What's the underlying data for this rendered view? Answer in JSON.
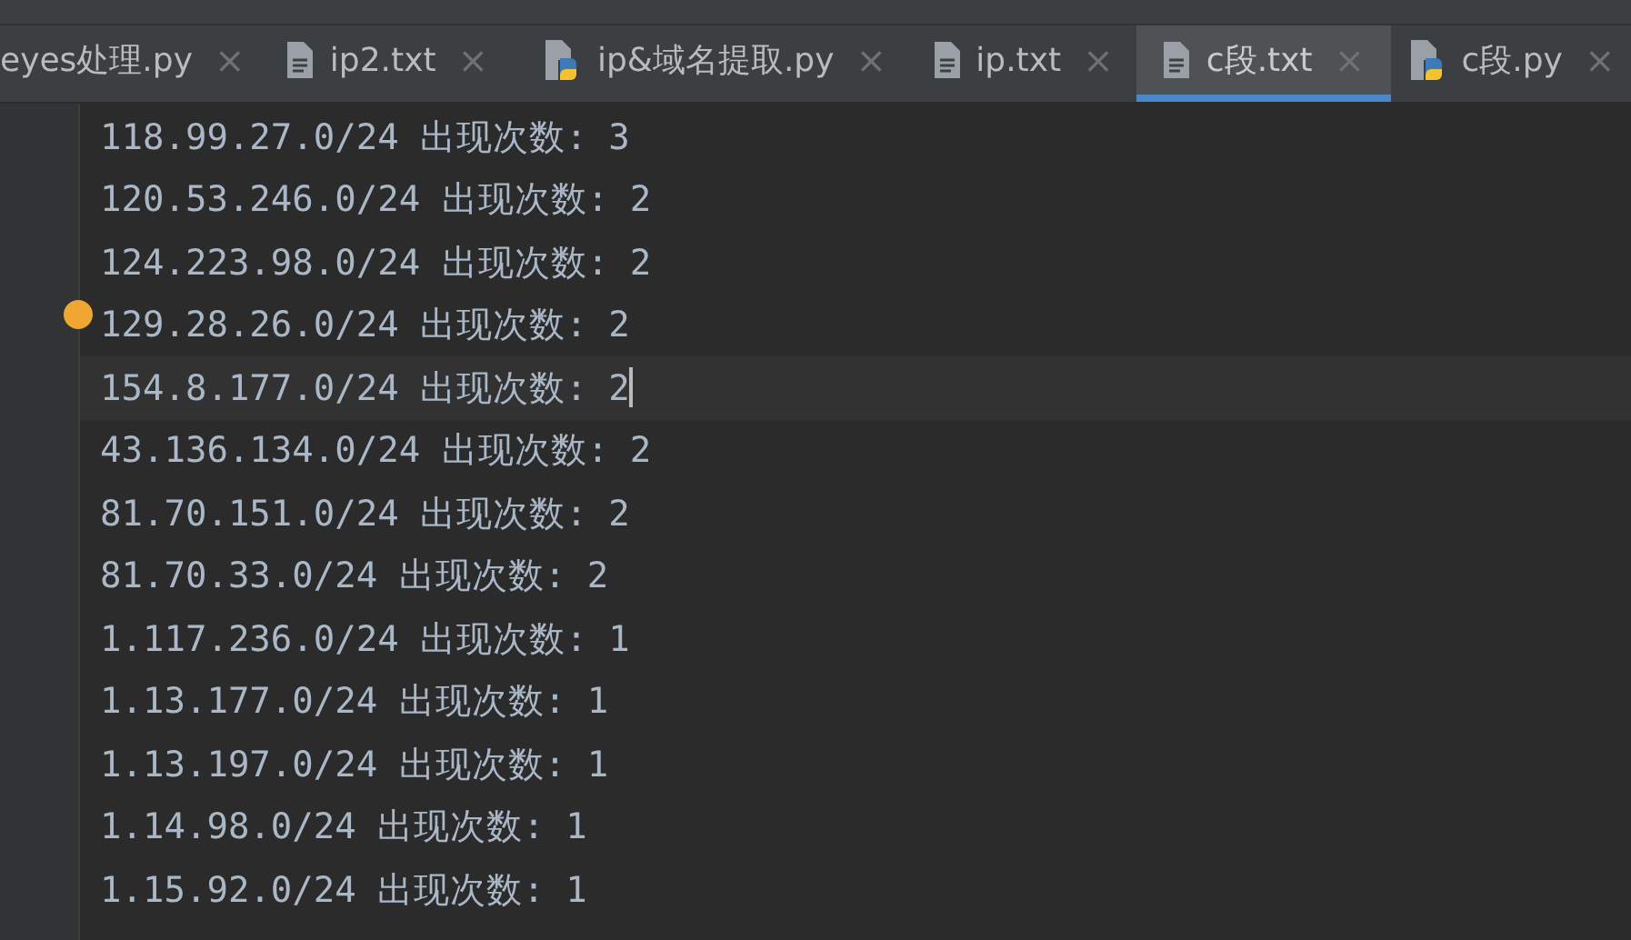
{
  "tabs": [
    {
      "label": "eyes处理.py",
      "selected": false
    },
    {
      "label": "ip2.txt",
      "kind": "text",
      "selected": false
    },
    {
      "label": "ip&域名提取.py",
      "kind": "python",
      "selected": false
    },
    {
      "label": "ip.txt",
      "kind": "text",
      "selected": false
    },
    {
      "label": "c段.txt",
      "kind": "text",
      "selected": true
    },
    {
      "label": "c段.py",
      "kind": "python",
      "selected": false
    }
  ],
  "close_glyph": "×",
  "lines": [
    {
      "text": "118.99.27.0/24 出现次数: 3",
      "current": false,
      "bulb": false
    },
    {
      "text": "120.53.246.0/24 出现次数: 2",
      "current": false,
      "bulb": false
    },
    {
      "text": "124.223.98.0/24 出现次数: 2",
      "current": false,
      "bulb": false
    },
    {
      "text": "129.28.26.0/24 出现次数: 2",
      "current": false,
      "bulb": true
    },
    {
      "text": "154.8.177.0/24 出现次数: 2",
      "current": true,
      "bulb": false
    },
    {
      "text": "43.136.134.0/24 出现次数: 2",
      "current": false,
      "bulb": false
    },
    {
      "text": "81.70.151.0/24 出现次数: 2",
      "current": false,
      "bulb": false
    },
    {
      "text": "81.70.33.0/24 出现次数: 2",
      "current": false,
      "bulb": false
    },
    {
      "text": "1.117.236.0/24 出现次数: 1",
      "current": false,
      "bulb": false
    },
    {
      "text": "1.13.177.0/24 出现次数: 1",
      "current": false,
      "bulb": false
    },
    {
      "text": "1.13.197.0/24 出现次数: 1",
      "current": false,
      "bulb": false
    },
    {
      "text": "1.14.98.0/24 出现次数: 1",
      "current": false,
      "bulb": false
    },
    {
      "text": "1.15.92.0/24 出现次数: 1",
      "current": false,
      "bulb": false
    }
  ]
}
